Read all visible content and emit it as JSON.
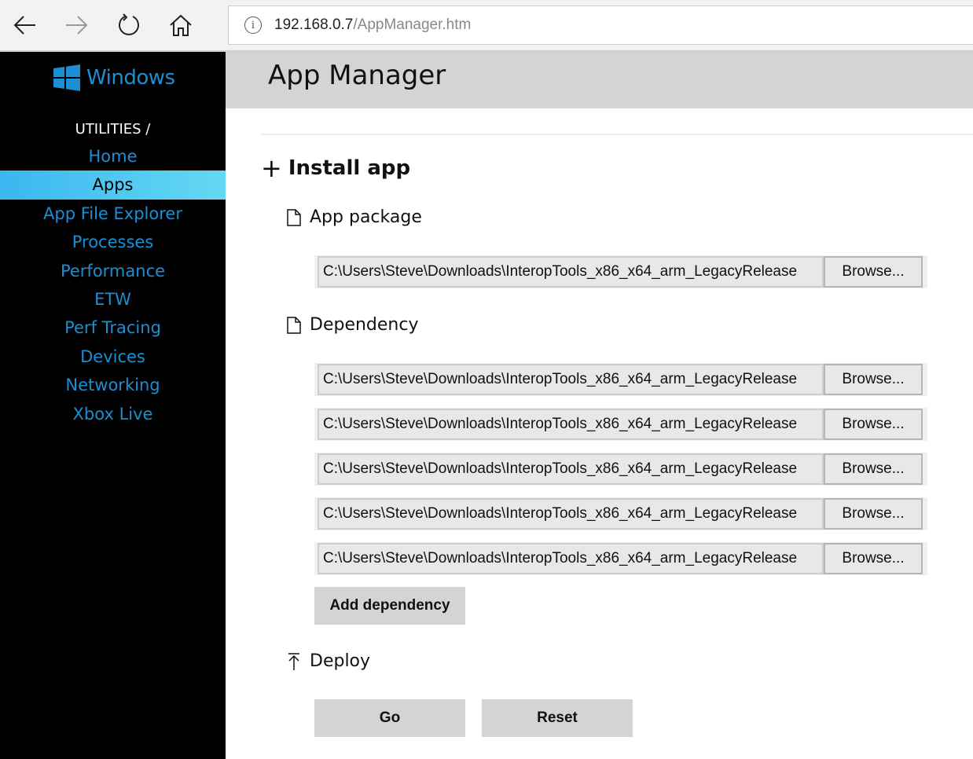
{
  "browser": {
    "back_icon": "arrow-left-icon",
    "forward_icon": "arrow-right-icon",
    "refresh_icon": "refresh-icon",
    "home_icon": "home-icon",
    "info_icon": "info-icon",
    "info_glyph": "i",
    "url_host": "192.168.0.7",
    "url_path": "/AppManager.htm"
  },
  "sidebar": {
    "logo_text": "Windows",
    "heading": "UTILITIES /",
    "items": [
      {
        "label": "Home",
        "active": false
      },
      {
        "label": "Apps",
        "active": true
      },
      {
        "label": "App File Explorer",
        "active": false
      },
      {
        "label": "Processes",
        "active": false
      },
      {
        "label": "Performance",
        "active": false
      },
      {
        "label": "ETW",
        "active": false
      },
      {
        "label": "Perf Tracing",
        "active": false
      },
      {
        "label": "Devices",
        "active": false
      },
      {
        "label": "Networking",
        "active": false
      },
      {
        "label": "Xbox Live",
        "active": false
      }
    ],
    "colors": {
      "link": "#1a8fd4",
      "active_bg": "#3bb6f0"
    }
  },
  "main": {
    "title": "App Manager",
    "install": {
      "plus_glyph": "+",
      "title": "Install app",
      "app_package": {
        "label": "App package",
        "value": "C:\\Users\\Steve\\Downloads\\InteropTools_x86_x64_arm_LegacyRelease",
        "browse_label": "Browse..."
      },
      "dependency": {
        "label": "Dependency",
        "items": [
          {
            "value": "C:\\Users\\Steve\\Downloads\\InteropTools_x86_x64_arm_LegacyRelease",
            "browse_label": "Browse..."
          },
          {
            "value": "C:\\Users\\Steve\\Downloads\\InteropTools_x86_x64_arm_LegacyRelease",
            "browse_label": "Browse..."
          },
          {
            "value": "C:\\Users\\Steve\\Downloads\\InteropTools_x86_x64_arm_LegacyRelease",
            "browse_label": "Browse..."
          },
          {
            "value": "C:\\Users\\Steve\\Downloads\\InteropTools_x86_x64_arm_LegacyRelease",
            "browse_label": "Browse..."
          },
          {
            "value": "C:\\Users\\Steve\\Downloads\\InteropTools_x86_x64_arm_LegacyRelease",
            "browse_label": "Browse..."
          }
        ],
        "add_label": "Add dependency"
      },
      "deploy": {
        "label": "Deploy",
        "go_label": "Go",
        "reset_label": "Reset"
      }
    }
  }
}
